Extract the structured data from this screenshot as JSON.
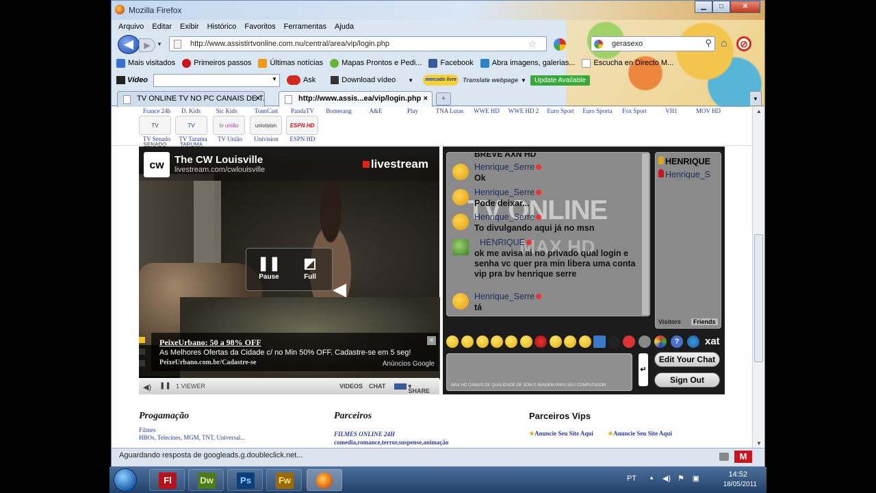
{
  "window": {
    "title": "Mozilla Firefox",
    "minimize": "▁",
    "maximize": "□",
    "close": "✕"
  },
  "menu": [
    "Arquivo",
    "Editar",
    "Exibir",
    "Histórico",
    "Favoritos",
    "Ferramentas",
    "Ajuda"
  ],
  "nav": {
    "url": "http://www.assistirtvonline.com.nu/central/area/vip/login.php",
    "search_value": "gerasexo"
  },
  "bookmarks": [
    {
      "label": "Mais visitados",
      "color": "#3a6fd1"
    },
    {
      "label": "Primeiros passos",
      "color": "#c8141c"
    },
    {
      "label": "Últimas notícias",
      "color": "#f29a1a"
    },
    {
      "label": "Mapas Prontos e Pedi...",
      "color": "#6bb13c"
    },
    {
      "label": "Facebook",
      "color": "#3b5998"
    },
    {
      "label": "Abra imagens, galerias...",
      "color": "#2d82c9"
    },
    {
      "label": "Escucha en Directo M...",
      "color": "#fff"
    }
  ],
  "toolbar": {
    "video_label": "Vídeo",
    "ask_label": "Ask",
    "download_label": "Download vídeo",
    "mercado_label": "mercado livre",
    "translate_label": "Translate webpage",
    "update_label": "Update Available"
  },
  "tabs": [
    {
      "label": "TV ONLINE TV NO PC CANAIS DE T...",
      "active": false
    },
    {
      "label": "http://www.assis...ea/vip/login.php",
      "active": true
    }
  ],
  "channels_top": [
    "France 24h",
    "D. Kids",
    "Sic Kids",
    "TonnCast",
    "PandaTV",
    "Bomerang",
    "A&E",
    "Play",
    "TNA Lutas",
    "WWE HD",
    "WWE HD 2",
    "Euro Sport",
    "Euro Sporta",
    "Fox Sport",
    "VH1",
    "MOV HD"
  ],
  "channel_logos": [
    "TV SENADO",
    "TV TARUMA",
    "tv união",
    "univision",
    "ESPN HD"
  ],
  "channels_bottom": [
    "TV Senado",
    "TV Taruma",
    "TV União",
    "Univision",
    "ESPN HD"
  ],
  "player": {
    "channel_title": "The CW Louisville",
    "channel_url": "livestream.com/cwlouisville",
    "logo_text": "cw",
    "brand": "livestream",
    "pause_label": "Pause",
    "full_label": "Full",
    "ad": {
      "title": "PeixeUrbano: 50 a 98% OFF",
      "body": "As Melhores Ofertas da Cidade c/ no Min 50% OFF. Cadastre-se em 5 seg!",
      "url": "PeixeUrbano.com.br/Cadastre-se",
      "sponsor": "Anúncios Google",
      "close": "×"
    },
    "viewers": "1 VIEWER",
    "videos": "VIDEOS",
    "chat": "CHAT",
    "share": "SHARE"
  },
  "chat": {
    "watermark": "TV ONLINE",
    "watermark2": "MAX HD",
    "top_cut": "BREVE AXN HD",
    "messages": [
      {
        "name": "Henrique_Serre",
        "text": "Ok"
      },
      {
        "name": "Henrique_Serre",
        "text": "Pode deixar..."
      },
      {
        "name": "Henrique_Serre",
        "text": "To divulgando aqui já no msn"
      },
      {
        "name": "HENRIQUE",
        "text": "ok me avisa ai no privado qual login e senha vc quer pra min libera uma conta vip pra bv henrique serre"
      },
      {
        "name": "Henrique_Serre",
        "text": "tá"
      }
    ],
    "users": [
      "HENRIQUE",
      "Henrique_S"
    ],
    "visitors_tab": "Visitors",
    "friends_tab": "Friends",
    "xat": "xat",
    "input_hint": "MAX HD CANAIS DE QUALIDADE DE SOM E IMAGEM PARA SEU COMPUTADOR",
    "enter": "↵",
    "edit_button": "Edit Your Chat",
    "signout_button": "Sign Out"
  },
  "footer": {
    "prog_title": "Progamação",
    "prog_l1": "Filmes",
    "prog_l2": "HBOs, Telecines, MGM, TNT, Universal...",
    "parc_title": "Parceiros",
    "parc_l1": "FILMES ONLINE 24H",
    "parc_l2": "comedia,romance,terror,suspense,animação",
    "vip_title": "Parceiros Vips",
    "vip_l1": "Anuncie Seu Site Aqui",
    "vip_l2": "Anuncie Seu Site Aqui"
  },
  "status": {
    "text": "Aguardando resposta de googleads.g.doubleclick.net..."
  },
  "taskbar": {
    "apps": [
      {
        "label": "Fl",
        "bg": "#b3141c",
        "fg": "#fff"
      },
      {
        "label": "Dw",
        "bg": "#4f7a1e",
        "fg": "#d7f0a3"
      },
      {
        "label": "Ps",
        "bg": "#0e3e7a",
        "fg": "#8fd1ff"
      },
      {
        "label": "Fw",
        "bg": "#9a6a0a",
        "fg": "#ffe27a"
      },
      {
        "label": "",
        "bg": "transparent",
        "fg": "#fff"
      }
    ],
    "lang": "PT",
    "time": "14:52",
    "date": "18/05/2011"
  }
}
